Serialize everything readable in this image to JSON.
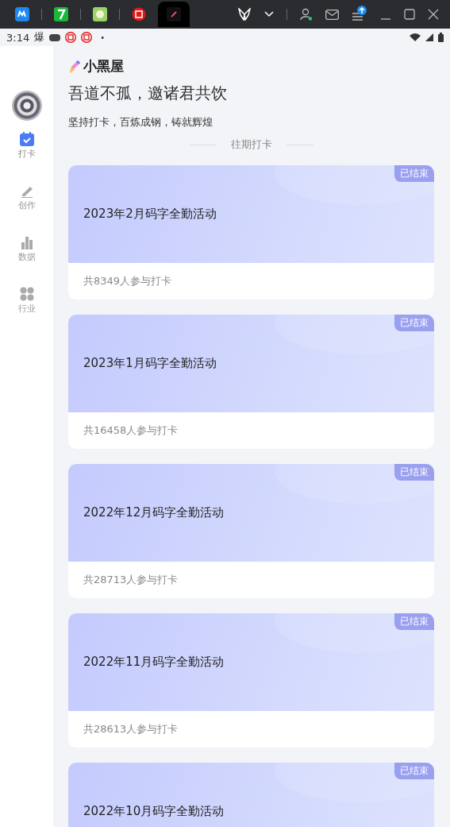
{
  "title_bar": {
    "tabs": [
      {
        "kind": "app-m",
        "selected": false
      },
      {
        "kind": "seven",
        "selected": false
      },
      {
        "kind": "cartoon",
        "selected": false
      },
      {
        "kind": "stamp",
        "selected": false
      },
      {
        "kind": "pen",
        "selected": true
      }
    ]
  },
  "status_bar": {
    "time": "3:14",
    "notice": "爆",
    "dot": "•"
  },
  "sidebar": {
    "items": [
      {
        "label": "打卡",
        "kind": "calendar",
        "selected": true
      },
      {
        "label": "创作",
        "kind": "pencil",
        "selected": false
      },
      {
        "label": "数据",
        "kind": "bars",
        "selected": false
      },
      {
        "label": "行业",
        "kind": "grid",
        "selected": false
      }
    ]
  },
  "header": {
    "logo": "小黑屋",
    "slogan": "吾道不孤，邀诸君共饮",
    "subtitle": "坚持打卡，百炼成钢，铸就辉煌",
    "section": "往期打卡"
  },
  "activities": [
    {
      "title": "2023年2月码字全勤活动",
      "participants": "共8349人参与打卡",
      "status": "已结束"
    },
    {
      "title": "2023年1月码字全勤活动",
      "participants": "共16458人参与打卡",
      "status": "已结束"
    },
    {
      "title": "2022年12月码字全勤活动",
      "participants": "共28713人参与打卡",
      "status": "已结束"
    },
    {
      "title": "2022年11月码字全勤活动",
      "participants": "共28613人参与打卡",
      "status": "已结束"
    },
    {
      "title": "2022年10月码字全勤活动",
      "status": "已结束"
    }
  ]
}
